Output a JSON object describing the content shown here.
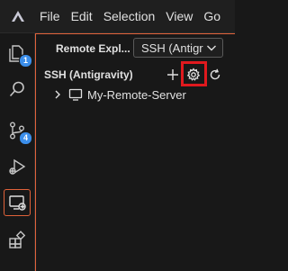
{
  "menubar": {
    "logo_icon": "antigravity-logo-icon",
    "items": [
      "File",
      "Edit",
      "Selection",
      "View",
      "Go"
    ]
  },
  "activity_bar": {
    "items": [
      {
        "icon": "explorer-icon",
        "badge": "1"
      },
      {
        "icon": "search-icon"
      },
      {
        "icon": "source-control-icon",
        "badge": "4"
      },
      {
        "icon": "run-debug-icon"
      },
      {
        "icon": "remote-explorer-icon",
        "active": true
      },
      {
        "icon": "extensions-icon"
      }
    ]
  },
  "panel": {
    "title": "Remote Expl...",
    "dropdown_value": "SSH (Antigr",
    "section_title": "SSH (Antigravity)",
    "actions": [
      "add-icon",
      "gear-icon",
      "refresh-icon"
    ],
    "tree": [
      {
        "label": "My-Remote-Server",
        "icon": "remote-monitor-icon",
        "expanded": false
      }
    ]
  },
  "colors": {
    "accent": "#e0623a",
    "highlight": "#e0191e",
    "badge": "#3b8eea"
  }
}
